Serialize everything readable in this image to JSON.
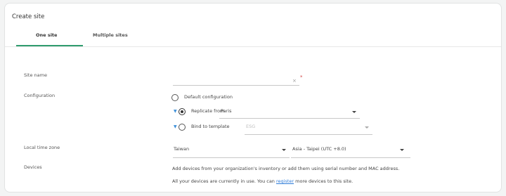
{
  "page": {
    "title": "Create site"
  },
  "tabs": [
    {
      "label": "One site",
      "active": true
    },
    {
      "label": "Multiple sites",
      "active": false
    }
  ],
  "form": {
    "site_name": {
      "label": "Site name",
      "value": "",
      "required_mark": "*",
      "clear_icon": "×"
    },
    "configuration": {
      "label": "Configuration",
      "options": [
        {
          "label": "Default configuration",
          "selected": false
        },
        {
          "label": "Replicate from",
          "selected": true,
          "select_value": "Paris"
        },
        {
          "label": "Bind to template",
          "selected": false,
          "select_value": "ESG"
        }
      ]
    },
    "timezone": {
      "label": "Local time zone",
      "country": "Taiwan",
      "zone": "Asia - Taipei (UTC +8.0)"
    },
    "devices": {
      "label": "Devices",
      "line1": "Add devices from your organization's inventory or add them using serial number and MAC address.",
      "line2_prefix": "All your devices are currently in use. You can ",
      "line2_link": "register",
      "line2_suffix": " more devices to this site."
    }
  },
  "colors": {
    "accent": "#2f9c6e",
    "link": "#2d7bd8",
    "pin": "#3b8fd9",
    "required": "#d04040"
  },
  "icons": [
    "pin-icon",
    "chevron-down-icon",
    "clear-icon"
  ]
}
